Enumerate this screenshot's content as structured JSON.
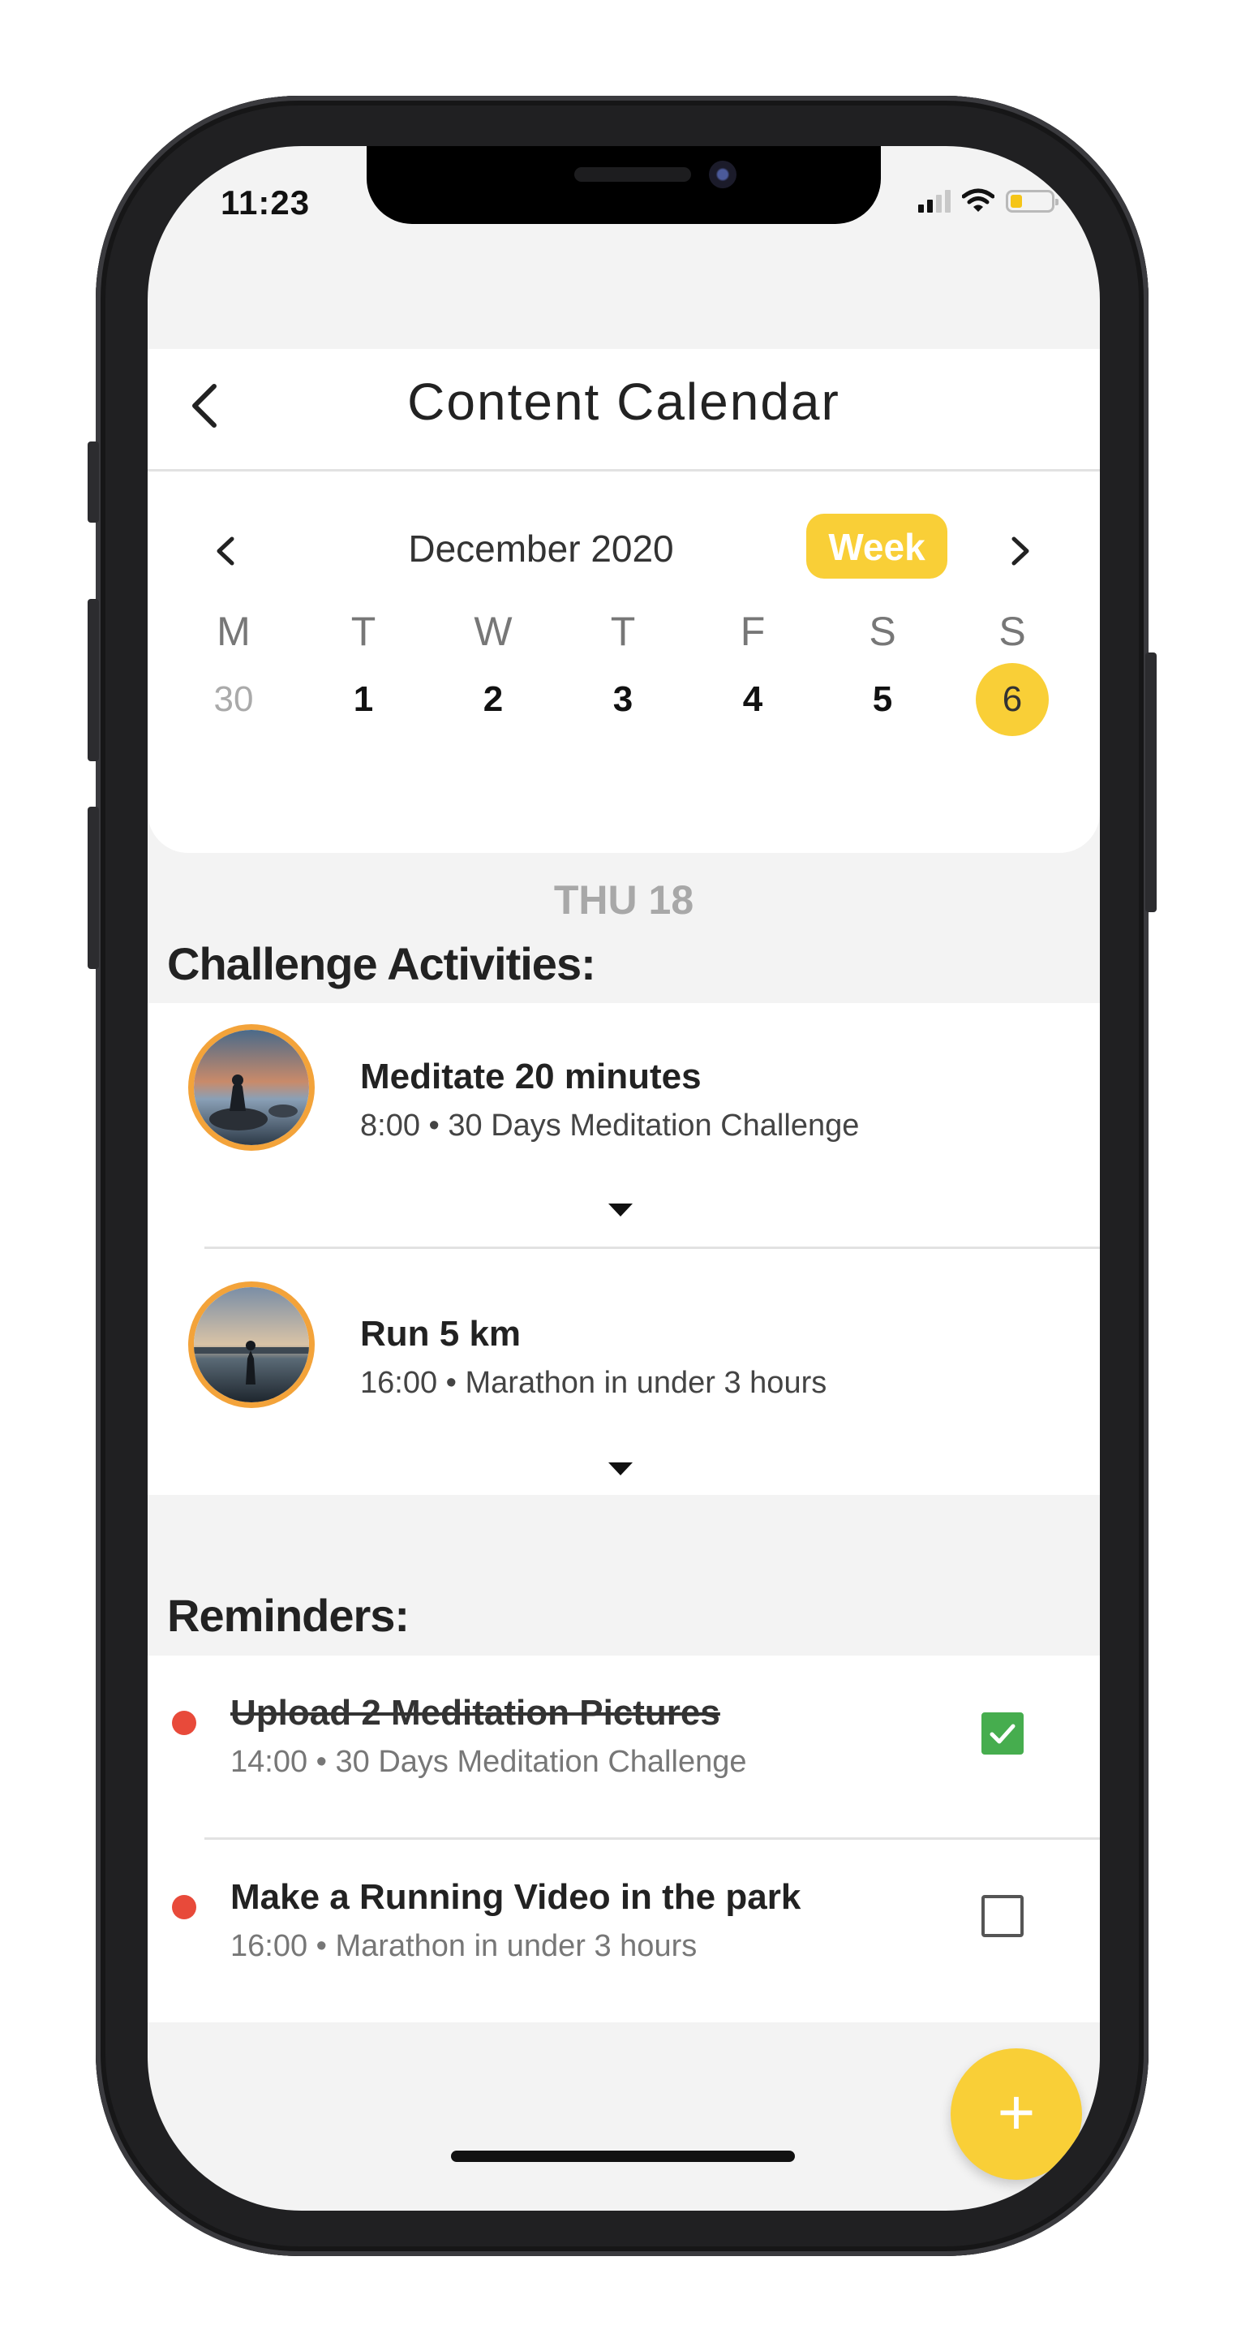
{
  "status_bar": {
    "time": "11:23"
  },
  "header": {
    "title": "Content Calendar",
    "back_icon": "chevron-left-icon"
  },
  "calendar": {
    "month_label": "December 2020",
    "view_toggle": "Week",
    "day_letters": [
      "M",
      "T",
      "W",
      "T",
      "F",
      "S",
      "S"
    ],
    "day_numbers": [
      "30",
      "1",
      "2",
      "3",
      "4",
      "5",
      "6"
    ],
    "selected_day": "6"
  },
  "date_heading": "THU 18",
  "challenge_section": {
    "title": "Challenge Activities:",
    "items": [
      {
        "title": "Meditate 20 minutes",
        "subtitle": "8:00 • 30 Days Meditation Challenge"
      },
      {
        "title": "Run 5 km",
        "subtitle": "16:00 • Marathon in under 3 hours"
      }
    ]
  },
  "reminders_section": {
    "title": "Reminders:",
    "items": [
      {
        "title": "Upload 2 Meditation Pictures",
        "subtitle": "14:00 • 30 Days Meditation Challenge",
        "done": true
      },
      {
        "title": "Make a Running Video in the park",
        "subtitle": "16:00 • Marathon in under 3 hours",
        "done": false
      }
    ]
  },
  "fab": {
    "label": "+"
  },
  "colors": {
    "accent": "#f9cf37",
    "ring": "#f3a33a",
    "dot": "#e84a3a",
    "check": "#46ad4e",
    "background": "#f3f3f3"
  }
}
